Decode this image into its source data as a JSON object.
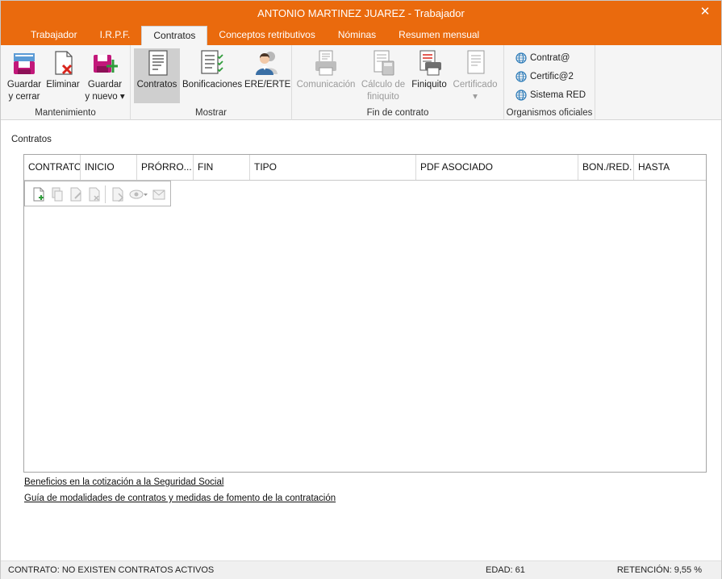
{
  "window": {
    "title": "ANTONIO MARTINEZ JUAREZ - Trabajador",
    "close_glyph": "✕"
  },
  "tabs": [
    {
      "label": "Trabajador"
    },
    {
      "label": "I.R.P.F."
    },
    {
      "label": "Contratos",
      "active": true
    },
    {
      "label": "Conceptos retributivos"
    },
    {
      "label": "Nóminas"
    },
    {
      "label": "Resumen mensual"
    }
  ],
  "ribbon": {
    "mantenimiento": {
      "label": "Mantenimiento",
      "guardar_cerrar": {
        "line1": "Guardar",
        "line2": "y cerrar",
        "icon": "save-close-icon"
      },
      "eliminar": {
        "line1": "Eliminar",
        "icon": "delete-document-icon"
      },
      "guardar_nuevo": {
        "line1": "Guardar",
        "line2": "y nuevo ▾",
        "icon": "save-new-icon"
      }
    },
    "mostrar": {
      "label": "Mostrar",
      "contratos": {
        "line1": "Contratos",
        "icon": "contract-document-icon"
      },
      "bonificaciones": {
        "line1": "Bonificaciones",
        "icon": "checklist-icon"
      },
      "ere_erte": {
        "line1": "ERE/ERTE",
        "icon": "person-icon"
      }
    },
    "fin_contrato": {
      "label": "Fin de contrato",
      "comunicacion": {
        "line1": "Comunicación",
        "icon": "printer-icon"
      },
      "calculo": {
        "line1": "Cálculo de",
        "line2": "finiquito",
        "icon": "calculator-icon"
      },
      "finiquito": {
        "line1": "Finiquito",
        "icon": "settlement-print-icon"
      },
      "certificado": {
        "line1": "Certificado",
        "line2": "▾",
        "icon": "certificate-icon"
      }
    },
    "organismos": {
      "label": "Organismos oficiales",
      "items": [
        {
          "label": "Contrat@",
          "icon": "globe-icon"
        },
        {
          "label": "Certific@2",
          "icon": "globe-icon"
        },
        {
          "label": "Sistema RED",
          "icon": "globe-icon"
        }
      ]
    }
  },
  "content": {
    "section_label": "Contratos",
    "columns": [
      "CONTRATO",
      "INICIO",
      "PRÓRRO...",
      "FIN",
      "TIPO",
      "PDF ASOCIADO",
      "BON./RED.",
      "HASTA"
    ],
    "links": [
      "Beneficios en la cotización a la Seguridad Social",
      "Guía de modalidades de contratos y medidas de fomento de la contratación"
    ]
  },
  "status": {
    "contract": "CONTRATO: NO EXISTEN CONTRATOS ACTIVOS",
    "age": "EDAD: 61",
    "retention": "RETENCIÓN: 9,55 %"
  },
  "colors": {
    "accent": "#ea6a0d",
    "ribbon_bg": "#f5f5f5",
    "selected_bg": "#cfcfcf"
  }
}
